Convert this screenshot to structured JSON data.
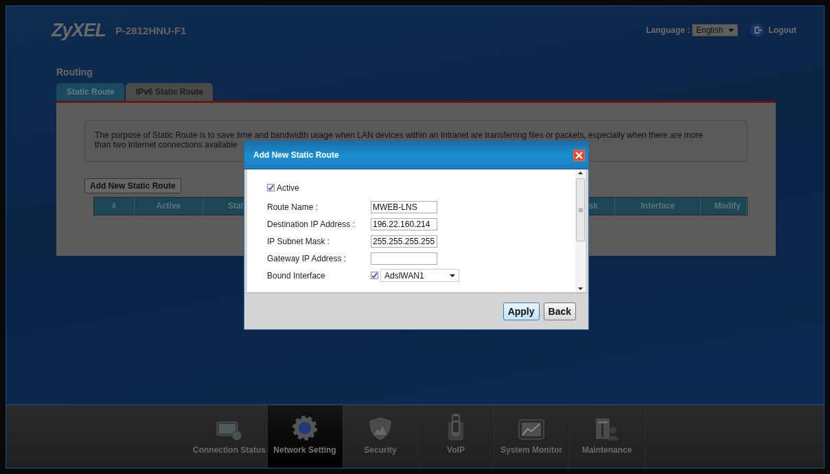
{
  "header": {
    "logo": "ZyXEL",
    "model": "P-2812HNU-F1",
    "language_label": "Language :",
    "language": "English",
    "logout": "Logout"
  },
  "page": {
    "title": "Routing",
    "tabs": [
      {
        "label": "Static Route",
        "selected": true
      },
      {
        "label": "IPv6 Static Route",
        "selected": false
      }
    ],
    "description": [
      "The purpose of Static Route is to save time and bandwidth usage when LAN devices within an Intranet are transferring files or packets, especially when there are more",
      "than two Internet connections available"
    ],
    "add_button": "Add New Static Route",
    "table": {
      "columns": [
        "#",
        "Active",
        "Stat",
        "sk",
        "Interface",
        "Modify"
      ]
    }
  },
  "dialog": {
    "title": "Add New Static Route",
    "fields": [
      {
        "kind": "checkbox",
        "label": "Active",
        "checked": true
      },
      {
        "kind": "text",
        "label": "Route Name :",
        "value": "MWEB-LNS"
      },
      {
        "kind": "text",
        "label": "Destination IP Address :",
        "value": "196.22.160.214"
      },
      {
        "kind": "text",
        "label": "IP Subnet Mask :",
        "value": "255.255.255.255"
      },
      {
        "kind": "text",
        "label": "Gateway IP Address :"
      },
      {
        "kind": "select",
        "label": "Bound Interface",
        "checked": true,
        "value": "AdslWAN1"
      }
    ],
    "buttons": [
      {
        "label": "Apply",
        "default": true
      },
      {
        "label": "Back",
        "default": false
      }
    ]
  },
  "nav": [
    {
      "kind": "monitor",
      "label": "Connection Status",
      "selected": false
    },
    {
      "kind": "gear",
      "label": "Network Setting",
      "selected": true
    },
    {
      "kind": "shield",
      "label": "Security",
      "selected": false
    },
    {
      "kind": "phone",
      "label": "VoIP",
      "selected": false
    },
    {
      "kind": "chart",
      "label": "System Monitor",
      "selected": false
    },
    {
      "kind": "tools",
      "label": "Maintenance",
      "selected": false
    }
  ]
}
